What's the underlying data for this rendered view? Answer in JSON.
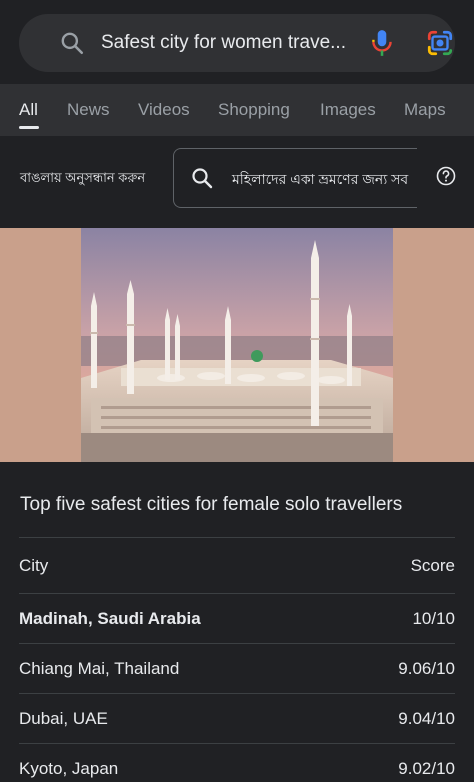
{
  "search": {
    "query": "Safest city for women trave..."
  },
  "tabs": [
    {
      "label": "All"
    },
    {
      "label": "News"
    },
    {
      "label": "Videos"
    },
    {
      "label": "Shopping"
    },
    {
      "label": "Images"
    },
    {
      "label": "Maps"
    }
  ],
  "bengali": {
    "label": "বাঙলায় অনুসন্ধান করুন",
    "query": "মহিলাদের একা ভ্রমণের জন্য সব"
  },
  "snippet": {
    "title": "Top five safest cities for female solo travellers",
    "headers": {
      "city": "City",
      "score": "Score"
    },
    "rows": [
      {
        "city": "Madinah, Saudi Arabia",
        "score": "10/10"
      },
      {
        "city": "Chiang Mai, Thailand",
        "score": "9.06/10"
      },
      {
        "city": "Dubai, UAE",
        "score": "9.04/10"
      },
      {
        "city": "Kyoto, Japan",
        "score": "9.02/10"
      }
    ]
  },
  "colors": {
    "background": "#202124",
    "surface": "#303134",
    "text": "#e8eaed",
    "muted": "#9aa0a6",
    "hero_bg": "#c9a08b"
  },
  "icons": [
    "search-icon",
    "mic-icon",
    "google-lens-icon",
    "help-icon"
  ]
}
